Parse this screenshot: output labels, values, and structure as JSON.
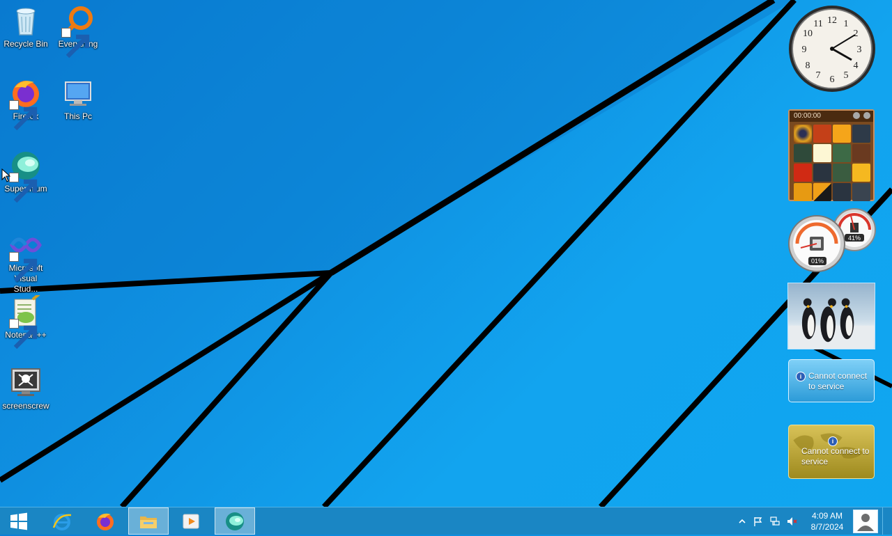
{
  "desktop": {
    "icons": [
      {
        "label": "Recycle Bin",
        "icon": "recycle-bin-icon"
      },
      {
        "label": "Everything",
        "icon": "everything-icon"
      },
      {
        "label": "Firefox",
        "icon": "firefox-icon"
      },
      {
        "label": "This Pc",
        "icon": "this-pc-icon"
      },
      {
        "label": "Supermium",
        "icon": "supermium-icon"
      },
      {
        "label": "Microsoft Visual Stud...",
        "icon": "visual-studio-icon"
      },
      {
        "label": "Notepad++",
        "icon": "notepadpp-icon"
      },
      {
        "label": "screenscrew",
        "icon": "screenscrew-icon"
      }
    ]
  },
  "gadgets": {
    "clock": {
      "time": "4:09"
    },
    "puzzle": {
      "timer": "00:00:00"
    },
    "meter": {
      "cpu": "01%",
      "memory": "41%",
      "cpu_level": 0.01,
      "memory_level": 0.41
    },
    "feed_1": {
      "message": "Cannot connect to service"
    },
    "feed_2": {
      "message": "Cannot connect to service"
    }
  },
  "taskbar": {
    "start": "start-icon",
    "apps": [
      {
        "icon": "internet-explorer-icon",
        "active": false
      },
      {
        "icon": "firefox-icon",
        "active": false
      },
      {
        "icon": "file-explorer-icon",
        "active": true
      },
      {
        "icon": "media-player-icon",
        "active": false
      },
      {
        "icon": "supermium-icon",
        "active": true
      }
    ],
    "tray": {
      "time": "4:09 AM",
      "date": "8/7/2024",
      "icons": [
        "show-hidden-icons-icon",
        "action-center-flag-icon",
        "network-icon",
        "volume-muted-icon"
      ]
    }
  },
  "colors": {
    "wallpaper": "#0f8fe0",
    "taskbar": "#1a86c4",
    "accent": "#ffffff"
  }
}
